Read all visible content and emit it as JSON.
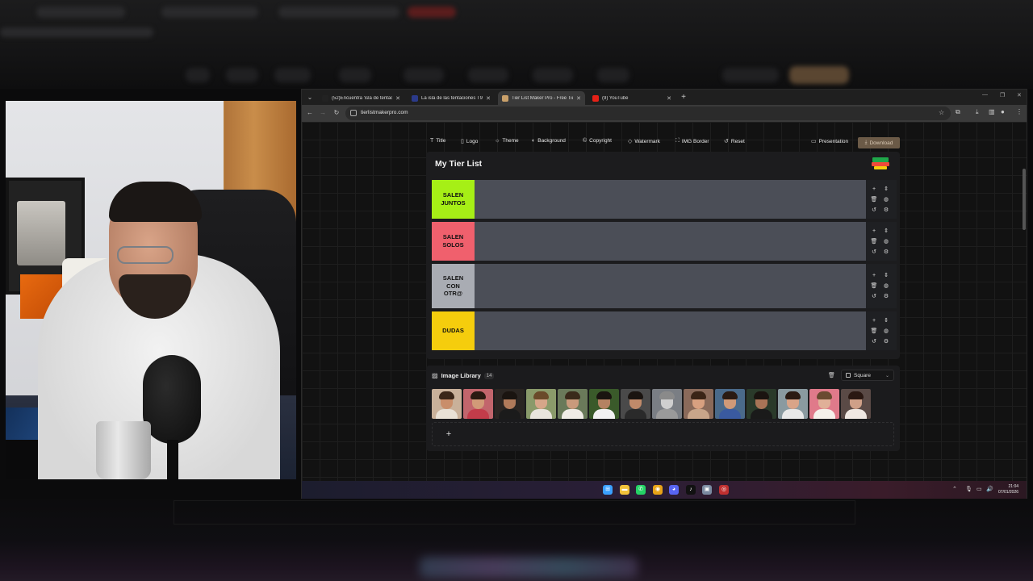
{
  "browser": {
    "tabs": [
      {
        "title": "(52)Encuentra 'isla de tentacio",
        "favicon_color": "#222222",
        "active": false
      },
      {
        "title": "La isla de las tentaciones T9 | M",
        "favicon_color": "#2b3a8a",
        "active": false
      },
      {
        "title": "Tier List Maker Pro - Free Tier L",
        "favicon_color": "#c9a06a",
        "active": true
      },
      {
        "title": "(9) YouTube",
        "favicon_color": "#e62117",
        "active": false
      }
    ],
    "new_tab": "+",
    "url": "tierlistmakerpro.com"
  },
  "app_toolbar": {
    "items": [
      {
        "label": "Title",
        "icon": "text-icon",
        "glyph": "T"
      },
      {
        "label": "Logo",
        "icon": "file-icon",
        "glyph": "▯"
      },
      {
        "label": "Theme",
        "icon": "sun-icon",
        "glyph": "☼"
      },
      {
        "label": "Background",
        "icon": "palette-icon",
        "glyph": "◐"
      },
      {
        "label": "Copyright",
        "icon": "copyright-icon",
        "glyph": "©"
      },
      {
        "label": "Watermark",
        "icon": "drop-icon",
        "glyph": "◇"
      },
      {
        "label": "IMG Border",
        "icon": "border-icon",
        "glyph": "⛶"
      },
      {
        "label": "Reset",
        "icon": "reset-icon",
        "glyph": "↺"
      }
    ],
    "presentation": {
      "label": "Presentation",
      "glyph": "▭"
    },
    "download": {
      "label": "Download",
      "glyph": "⤓"
    }
  },
  "tierlist": {
    "title": "My Tier List",
    "tiers": [
      {
        "label": "SALEN JUNTOS",
        "color": "#a6ef16"
      },
      {
        "label": "SALEN SOLOS",
        "color": "#f0606d"
      },
      {
        "label": "SALEN CON OTR@",
        "color": "#a9acb3"
      },
      {
        "label": "DUDAS",
        "color": "#f5cd0d"
      }
    ],
    "controls": {
      "add": "+",
      "move": "⇕",
      "delete": "🗑",
      "color": "◍",
      "reset": "↺",
      "settings": "⚙"
    }
  },
  "library": {
    "title": "Image Library",
    "count": "14",
    "shape": "Square",
    "trash": "🗑",
    "add": "+",
    "thumbs": [
      {
        "bg": "#c9b19a",
        "skin": "#c98e6a",
        "hair": "#3a2618",
        "cloth": "#e9e1d6"
      },
      {
        "bg": "#c2656c",
        "skin": "#d29a78",
        "hair": "#2a1a12",
        "cloth": "#c33c4a"
      },
      {
        "bg": "#2a2522",
        "skin": "#b07a5a",
        "hair": "#1a1410",
        "cloth": "#1b1b1b"
      },
      {
        "bg": "#8a9a6a",
        "skin": "#d6a689",
        "hair": "#6a4a2a",
        "cloth": "#e9e4dd"
      },
      {
        "bg": "#6a7a5a",
        "skin": "#c99a7c",
        "hair": "#3a2a1a",
        "cloth": "#f0ece6"
      },
      {
        "bg": "#3a5a2a",
        "skin": "#b48262",
        "hair": "#1a1410",
        "cloth": "#f2f2f2"
      },
      {
        "bg": "#4a4a4a",
        "skin": "#c08a6a",
        "hair": "#1a1410",
        "cloth": "#2a2a2a"
      },
      {
        "bg": "#7a7e84",
        "skin": "#cfcfcf",
        "hair": "#8a8a8a",
        "cloth": "#9a9a9a"
      },
      {
        "bg": "#8a6a5a",
        "skin": "#d8a080",
        "hair": "#3a2416",
        "cloth": "#c8a58a"
      },
      {
        "bg": "#4a6a8a",
        "skin": "#d09a78",
        "hair": "#2a1a12",
        "cloth": "#3a5aa0"
      },
      {
        "bg": "#2a3a2a",
        "skin": "#a87456",
        "hair": "#1a1410",
        "cloth": "#1a1a1a"
      },
      {
        "bg": "#8a9aa0",
        "skin": "#d9a488",
        "hair": "#2a1a12",
        "cloth": "#e8e8e8"
      },
      {
        "bg": "#e07a8a",
        "skin": "#e0b098",
        "hair": "#6a4a30",
        "cloth": "#f5f0ea"
      },
      {
        "bg": "#5a4a46",
        "skin": "#cfa088",
        "hair": "#2a1812",
        "cloth": "#f0e8e2"
      }
    ]
  },
  "taskbar": {
    "apps": [
      {
        "name": "windows-start-icon",
        "color": "#3aa0ff",
        "glyph": "⊞"
      },
      {
        "name": "file-explorer-icon",
        "color": "#f2c23a",
        "glyph": "▬"
      },
      {
        "name": "whatsapp-icon",
        "color": "#25d366",
        "glyph": "✆"
      },
      {
        "name": "chrome-icon",
        "color": "#e8a317",
        "glyph": "◉"
      },
      {
        "name": "discord-icon",
        "color": "#5865f2",
        "glyph": "◕"
      },
      {
        "name": "tiktok-icon",
        "color": "#111111",
        "glyph": "♪"
      },
      {
        "name": "app-icon",
        "color": "#7a8aa0",
        "glyph": "▣"
      },
      {
        "name": "recording-app-icon",
        "color": "#c03030",
        "glyph": "◎"
      }
    ],
    "time": "21:04",
    "date": "07/01/2026"
  }
}
